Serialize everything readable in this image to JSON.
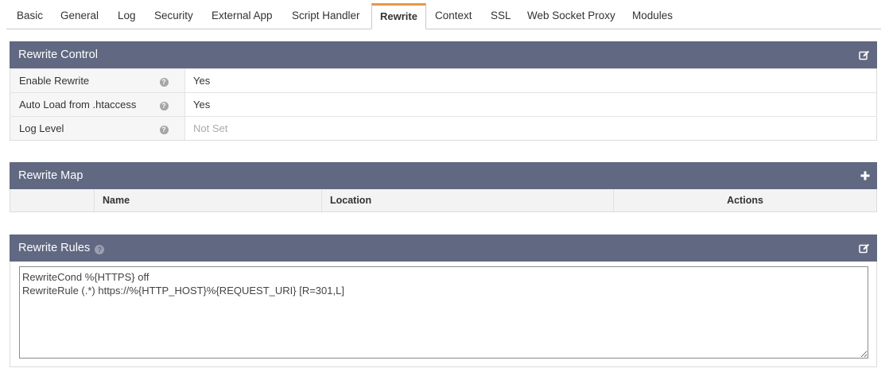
{
  "tabs": [
    {
      "label": "Basic"
    },
    {
      "label": "General"
    },
    {
      "label": "Log"
    },
    {
      "label": "Security"
    },
    {
      "label": "External App"
    },
    {
      "label": "Script Handler"
    },
    {
      "label": "Rewrite",
      "active": true
    },
    {
      "label": "Context"
    },
    {
      "label": "SSL"
    },
    {
      "label": "Web Socket Proxy"
    },
    {
      "label": "Modules"
    }
  ],
  "rewrite_control": {
    "title": "Rewrite Control",
    "edit_icon": "edit-icon",
    "rows": [
      {
        "label": "Enable Rewrite",
        "value": "Yes"
      },
      {
        "label": "Auto Load from .htaccess",
        "value": "Yes"
      },
      {
        "label": "Log Level",
        "value": "Not Set"
      }
    ]
  },
  "rewrite_map": {
    "title": "Rewrite Map",
    "add_icon": "plus-icon",
    "columns": [
      "",
      "Name",
      "Location",
      "Actions"
    ]
  },
  "rewrite_rules": {
    "title": "Rewrite Rules",
    "edit_icon": "edit-icon",
    "value": "RewriteCond %{HTTPS} off\nRewriteRule (.*) https://%{HTTP_HOST}%{REQUEST_URI} [R=301,L]"
  },
  "colors": {
    "panel_header": "#616881",
    "active_tab_accent": "#e49a43"
  }
}
